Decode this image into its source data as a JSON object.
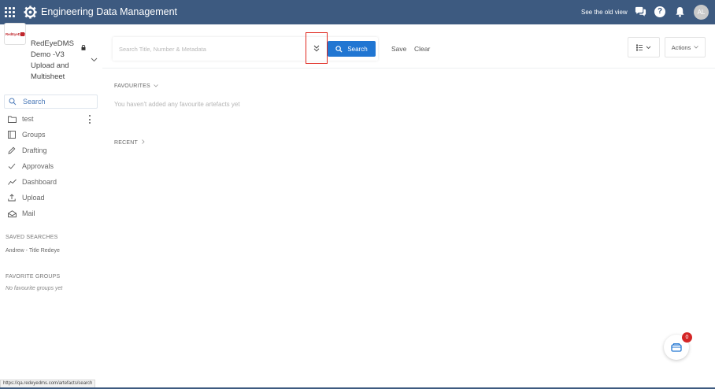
{
  "topbar": {
    "title": "Engineering Data Management",
    "old_view_label": "See the old view",
    "avatar_initials": "AL",
    "help_label": "?",
    "background_color": "#3d5a80"
  },
  "project": {
    "name": "RedEyeDMS Demo -V3 Upload and Multisheet",
    "logo_text": "RedEyeDMS",
    "locked": true
  },
  "nav": {
    "items": [
      {
        "label": "Search",
        "icon": "search-icon",
        "active": true
      },
      {
        "label": "test",
        "icon": "folder-icon"
      },
      {
        "label": "Groups",
        "icon": "groups-icon"
      },
      {
        "label": "Drafting",
        "icon": "pencil-icon"
      },
      {
        "label": "Approvals",
        "icon": "check-icon"
      },
      {
        "label": "Dashboard",
        "icon": "chart-line-icon"
      },
      {
        "label": "Upload",
        "icon": "upload-icon"
      },
      {
        "label": "Mail",
        "icon": "mail-icon"
      }
    ]
  },
  "saved_searches": {
    "title": "SAVED SEARCHES",
    "items": [
      "Andrew - Title Redeye"
    ]
  },
  "favorite_groups": {
    "title": "FAVORITE GROUPS",
    "empty_text": "No favourite groups yet"
  },
  "search": {
    "placeholder": "Search Title, Number & Metadata",
    "value": "",
    "button_label": "Search",
    "save_label": "Save",
    "clear_label": "Clear",
    "accent_color": "#2176d2"
  },
  "toolbar": {
    "actions_label": "Actions"
  },
  "favourites": {
    "title": "FAVOURITES",
    "empty_text": "You haven't added any favourite artefacts yet"
  },
  "recent": {
    "title": "RECENT"
  },
  "basket": {
    "count": "0",
    "badge_color": "#d42626"
  },
  "status_bar": {
    "url": "https://qa.redeyedms.com/artefacts/search"
  }
}
